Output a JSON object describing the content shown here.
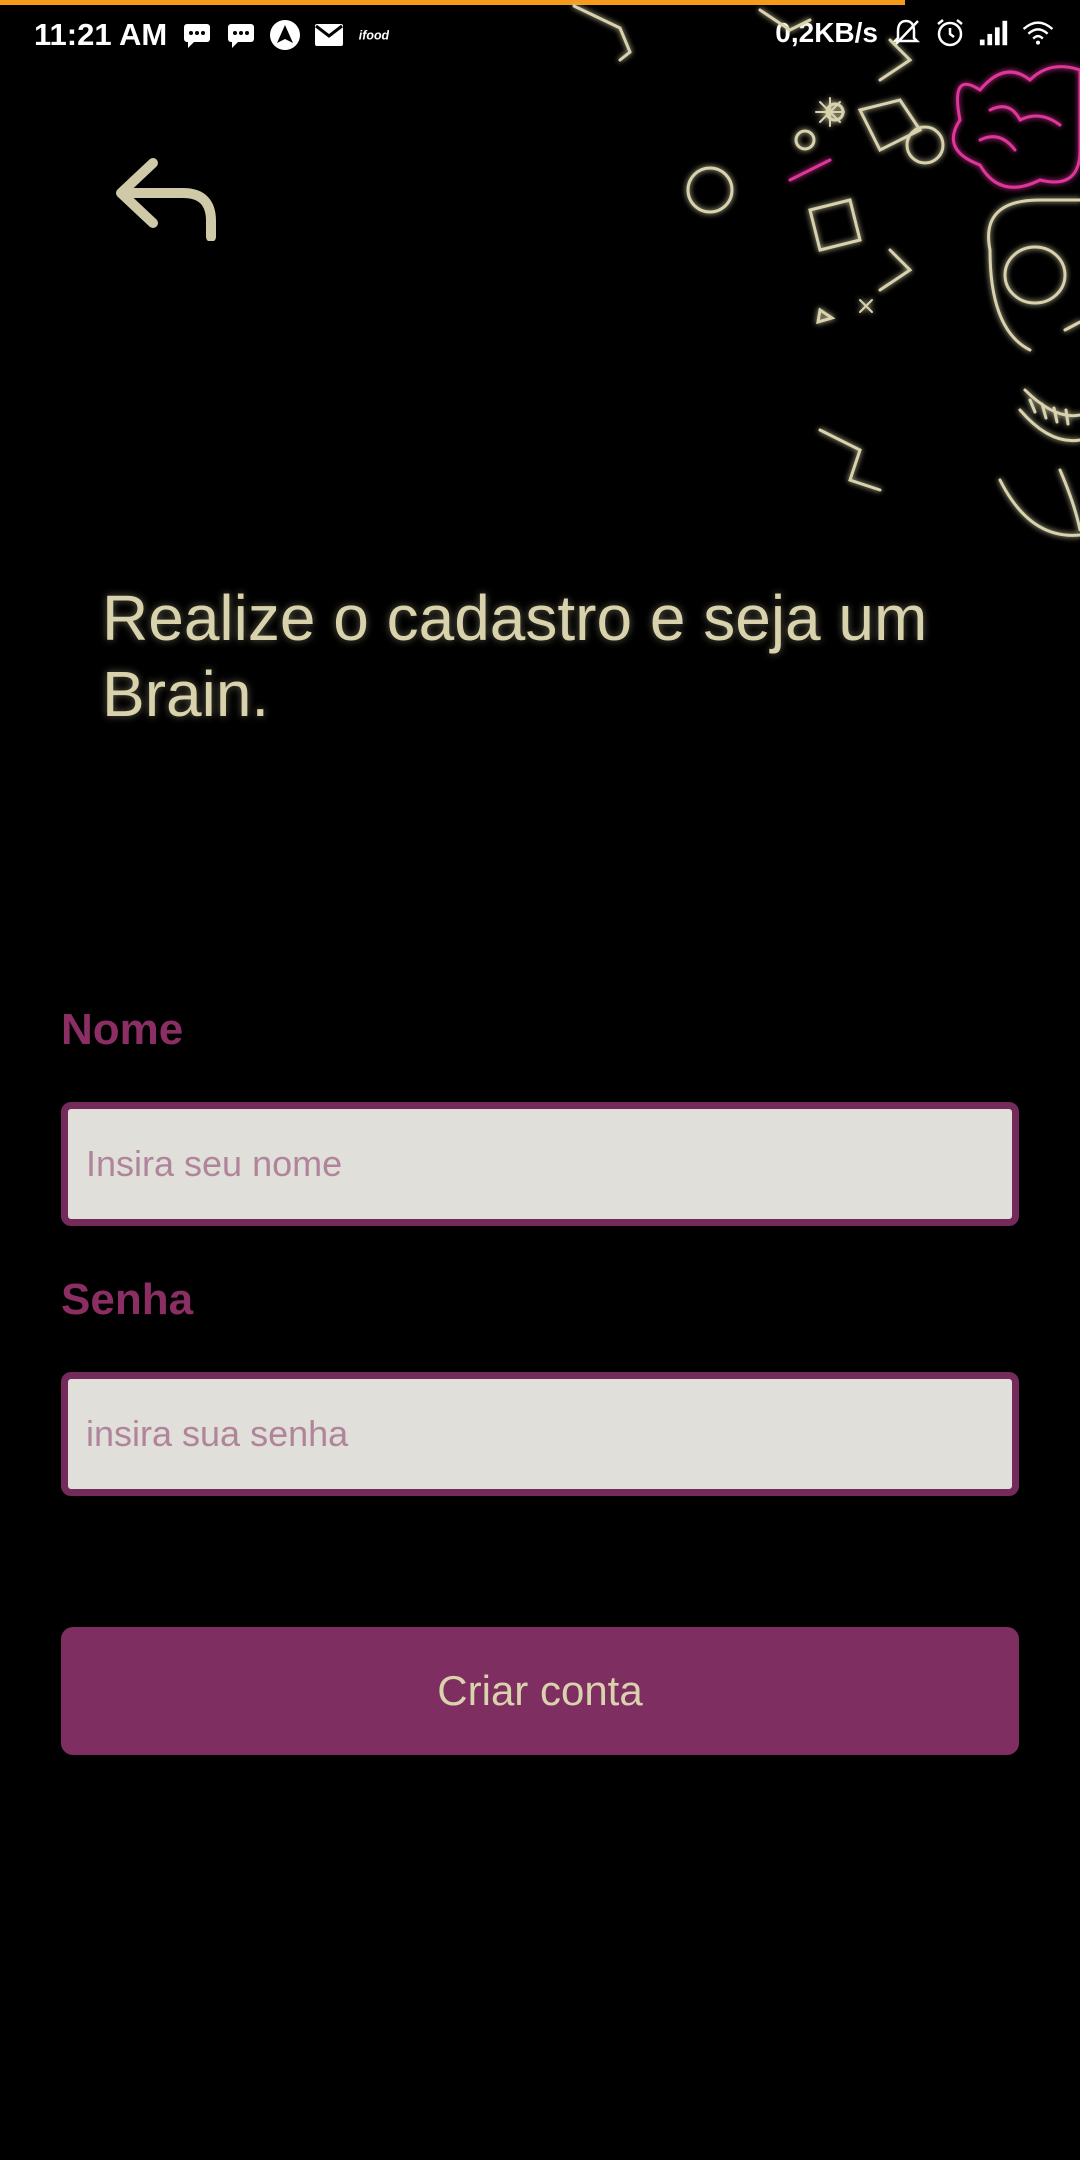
{
  "status_bar": {
    "time": "11:21 AM",
    "left_icons": [
      "message-icon",
      "message-icon",
      "navigation-icon",
      "gmail-icon",
      "ifood-icon"
    ],
    "network_speed": "0,2KB/s",
    "right_icons": [
      "muted-bell-icon",
      "alarm-icon",
      "signal-icon",
      "wifi-icon"
    ]
  },
  "header": {
    "back_icon": "back-arrow-icon"
  },
  "hero": {
    "headline": "Realize o cadastro e seja um Brain."
  },
  "form": {
    "name_label": "Nome",
    "name_placeholder": "Insira seu nome",
    "name_value": "",
    "password_label": "Senha",
    "password_placeholder": "insira sua senha",
    "password_value": "",
    "submit_label": "Criar conta"
  },
  "theme": {
    "background": "#000000",
    "accent": "#7e2e61",
    "label_color": "#8a2e64",
    "headline_color": "#d9d3ad",
    "input_bg": "#e1dfd9",
    "progress_line": "#f59a1b"
  }
}
